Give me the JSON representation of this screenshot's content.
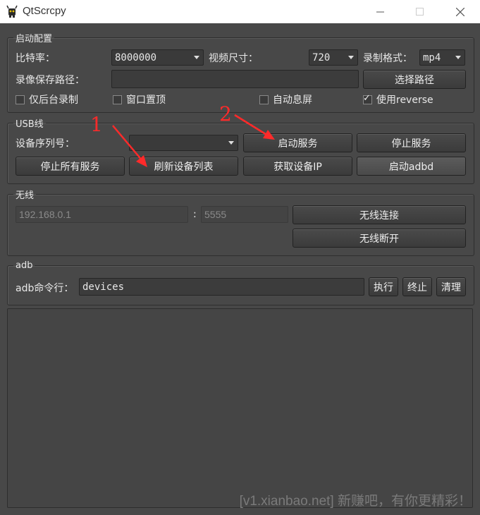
{
  "window": {
    "title": "QtScrcpy",
    "icon": "android-app-icon",
    "controls": [
      "minimize-icon",
      "maximize-icon",
      "close-icon"
    ]
  },
  "launch": {
    "group_title": "启动配置",
    "bitrate_label": "比特率：",
    "bitrate_value": "8000000",
    "video_size_label": "视频尺寸：",
    "video_size_value": "720",
    "record_format_label": "录制格式：",
    "record_format_value": "mp4",
    "record_path_label": "录像保存路径：",
    "record_path_value": "",
    "select_path_button": "选择路径",
    "checkboxes": [
      {
        "label": "仅后台录制",
        "checked": false
      },
      {
        "label": "窗口置顶",
        "checked": false
      },
      {
        "label": "自动息屏",
        "checked": false
      },
      {
        "label": "使用reverse",
        "checked": true
      }
    ]
  },
  "usb": {
    "group_title": "USB线",
    "serial_label": "设备序列号：",
    "serial_value": "",
    "start_service": "启动服务",
    "stop_service": "停止服务",
    "stop_all": "停止所有服务",
    "refresh_devices": "刷新设备列表",
    "get_ip": "获取设备IP",
    "start_adbd": "启动adbd"
  },
  "wireless": {
    "group_title": "无线",
    "ip_value": "192.168.0.1",
    "separator": ":",
    "port_value": "5555",
    "connect": "无线连接",
    "disconnect": "无线断开"
  },
  "adb": {
    "group_title": "adb",
    "cmd_label": "adb命令行：",
    "cmd_value": "devices",
    "execute": "执行",
    "terminate": "终止",
    "clear": "清理"
  },
  "log": {
    "text": ""
  },
  "annotations": {
    "step1": "1",
    "step2": "2",
    "color": "#ff2a2a"
  },
  "watermark": "[v1.xianbao.net] 新赚吧，有你更精彩！",
  "colors": {
    "background": "#484848",
    "titlebar": "#ffffff"
  }
}
